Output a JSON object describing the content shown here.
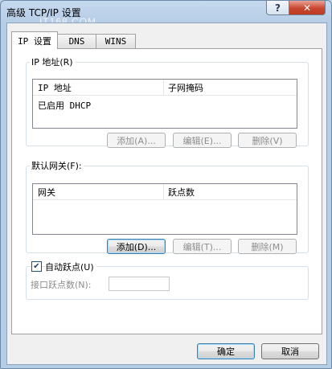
{
  "window": {
    "title": "高级 TCP/IP 设置",
    "watermark": "IT168.COM",
    "help_glyph": "?",
    "close_glyph": "✕"
  },
  "tabs": [
    {
      "label": "IP 设置",
      "active": true
    },
    {
      "label": "DNS",
      "active": false
    },
    {
      "label": "WINS",
      "active": false
    }
  ],
  "ip_address": {
    "legend": "IP 地址(R)",
    "columns": [
      "IP 地址",
      "子网掩码"
    ],
    "rows": [
      {
        "ip": "已启用 DHCP",
        "mask": ""
      }
    ],
    "buttons": {
      "add": "添加(A)...",
      "edit": "编辑(E)...",
      "remove": "删除(V)"
    }
  },
  "gateway": {
    "legend": "默认网关(F):",
    "columns": [
      "网关",
      "跃点数"
    ],
    "rows": [],
    "buttons": {
      "add": "添加(D)...",
      "edit": "编辑(T)...",
      "remove": "删除(M)"
    }
  },
  "metric": {
    "auto_label": "自动跃点(U)",
    "auto_checked": true,
    "check_glyph": "✔",
    "interface_label": "接口跃点数(N):",
    "interface_value": ""
  },
  "footer": {
    "ok": "确定",
    "cancel": "取消"
  }
}
